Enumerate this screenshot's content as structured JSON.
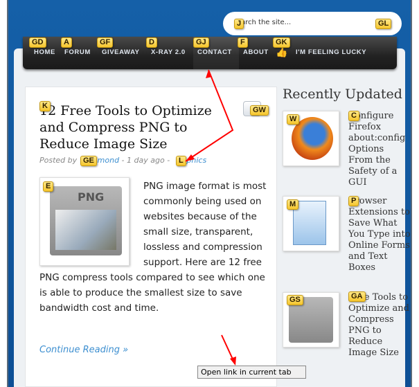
{
  "search": {
    "placeholder": "arch the site..."
  },
  "nav": {
    "items": [
      "HOME",
      "FORUM",
      "GIVEAWAY",
      "X-RAY 2.0",
      "CONTACT",
      "ABOUT",
      "I'M FEELING LUCKY"
    ]
  },
  "post": {
    "title": "12 Free Tools to Optimize and Compress PNG to Reduce Image Size",
    "meta_prefix": "Posted by",
    "author": "mond",
    "meta_mid": " - 1 day ago - ",
    "category": "aphics",
    "thumb_label": "PNG",
    "excerpt": "PNG image format is most commonly being used on websites because of the small size, transparent, lossless and compression support. Here are 12 free PNG compress tools compared to see which one is able to produce the smallest size to save bandwidth cost and time.",
    "more": "Continue Reading »"
  },
  "sidebar": {
    "title": "Recently Updated",
    "items": [
      {
        "title": "Configure Firefox about:config Options From the Safety of a GUI",
        "icon": "firefox-icon"
      },
      {
        "title": "Browser Extensions to Save What You Type into Online Forms and Text Boxes",
        "icon": "document-icon"
      },
      {
        "title": "Free Tools to Optimize and Compress PNG to Reduce Image Size",
        "icon": "png-icon"
      }
    ]
  },
  "hints": {
    "gd": "GD",
    "a": "A",
    "gf": "GF",
    "d": "D",
    "gj": "GJ",
    "f": "F",
    "gk": "GK",
    "j": "J",
    "gl": "GL",
    "k": "K",
    "gw": "GW",
    "ge": "GE",
    "l": "L",
    "e": "E",
    "w": "W",
    "c": "C",
    "m": "M",
    "p": "P",
    "gs": "GS",
    "ga": "GA"
  },
  "tooltip": "Open link in current tab",
  "colors": {
    "hint": "#f5c52c",
    "link": "#3d8fd0",
    "nav": "#222222",
    "arrow": "#ff0000"
  }
}
